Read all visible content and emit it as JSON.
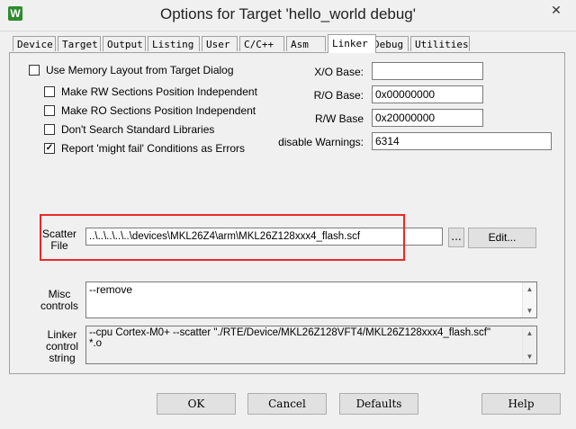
{
  "window": {
    "icon_letter": "W",
    "title": "Options for Target 'hello_world debug'",
    "close_glyph": "✕"
  },
  "tabs": [
    {
      "label": "Device"
    },
    {
      "label": "Target"
    },
    {
      "label": "Output"
    },
    {
      "label": "Listing"
    },
    {
      "label": "User"
    },
    {
      "label": "C/C++"
    },
    {
      "label": "Asm"
    },
    {
      "label": "Linker"
    },
    {
      "label": "Debug"
    },
    {
      "label": "Utilities"
    }
  ],
  "active_tab": "Linker",
  "options": {
    "use_memory_layout": {
      "label": "Use Memory Layout from Target Dialog",
      "checked": false
    },
    "make_rw": {
      "label": "Make RW Sections Position Independent",
      "checked": false
    },
    "make_ro": {
      "label": "Make RO Sections Position Independent",
      "checked": false
    },
    "dont_search": {
      "label": "Don't Search Standard Libraries",
      "checked": false
    },
    "report_might_fail": {
      "label": "Report 'might fail' Conditions as Errors",
      "checked": true
    }
  },
  "fields": {
    "xo_base": {
      "label": "X/O Base:",
      "value": ""
    },
    "ro_base": {
      "label": "R/O Base:",
      "value": "0x00000000"
    },
    "rw_base": {
      "label": "R/W Base",
      "value": "0x20000000"
    },
    "disable_warnings": {
      "label": "disable Warnings:",
      "value": "6314"
    }
  },
  "scatter": {
    "label_line1": "Scatter",
    "label_line2": "File",
    "value": "..\\..\\..\\..\\..\\devices\\MKL26Z4\\arm\\MKL26Z128xxx4_flash.scf",
    "browse_label": "...",
    "edit_label": "Edit..."
  },
  "misc": {
    "label_line1": "Misc",
    "label_line2": "controls",
    "value": "--remove"
  },
  "linker_string": {
    "label_line1": "Linker",
    "label_line2": "control",
    "label_line3": "string",
    "line1": "--cpu Cortex-M0+ --scatter \"./RTE/Device/MKL26Z128VFT4/MKL26Z128xxx4_flash.scf\"",
    "line2": "*.o"
  },
  "buttons": {
    "ok": "OK",
    "cancel": "Cancel",
    "defaults": "Defaults",
    "help": "Help"
  },
  "colors": {
    "highlight": "#e8292a"
  }
}
